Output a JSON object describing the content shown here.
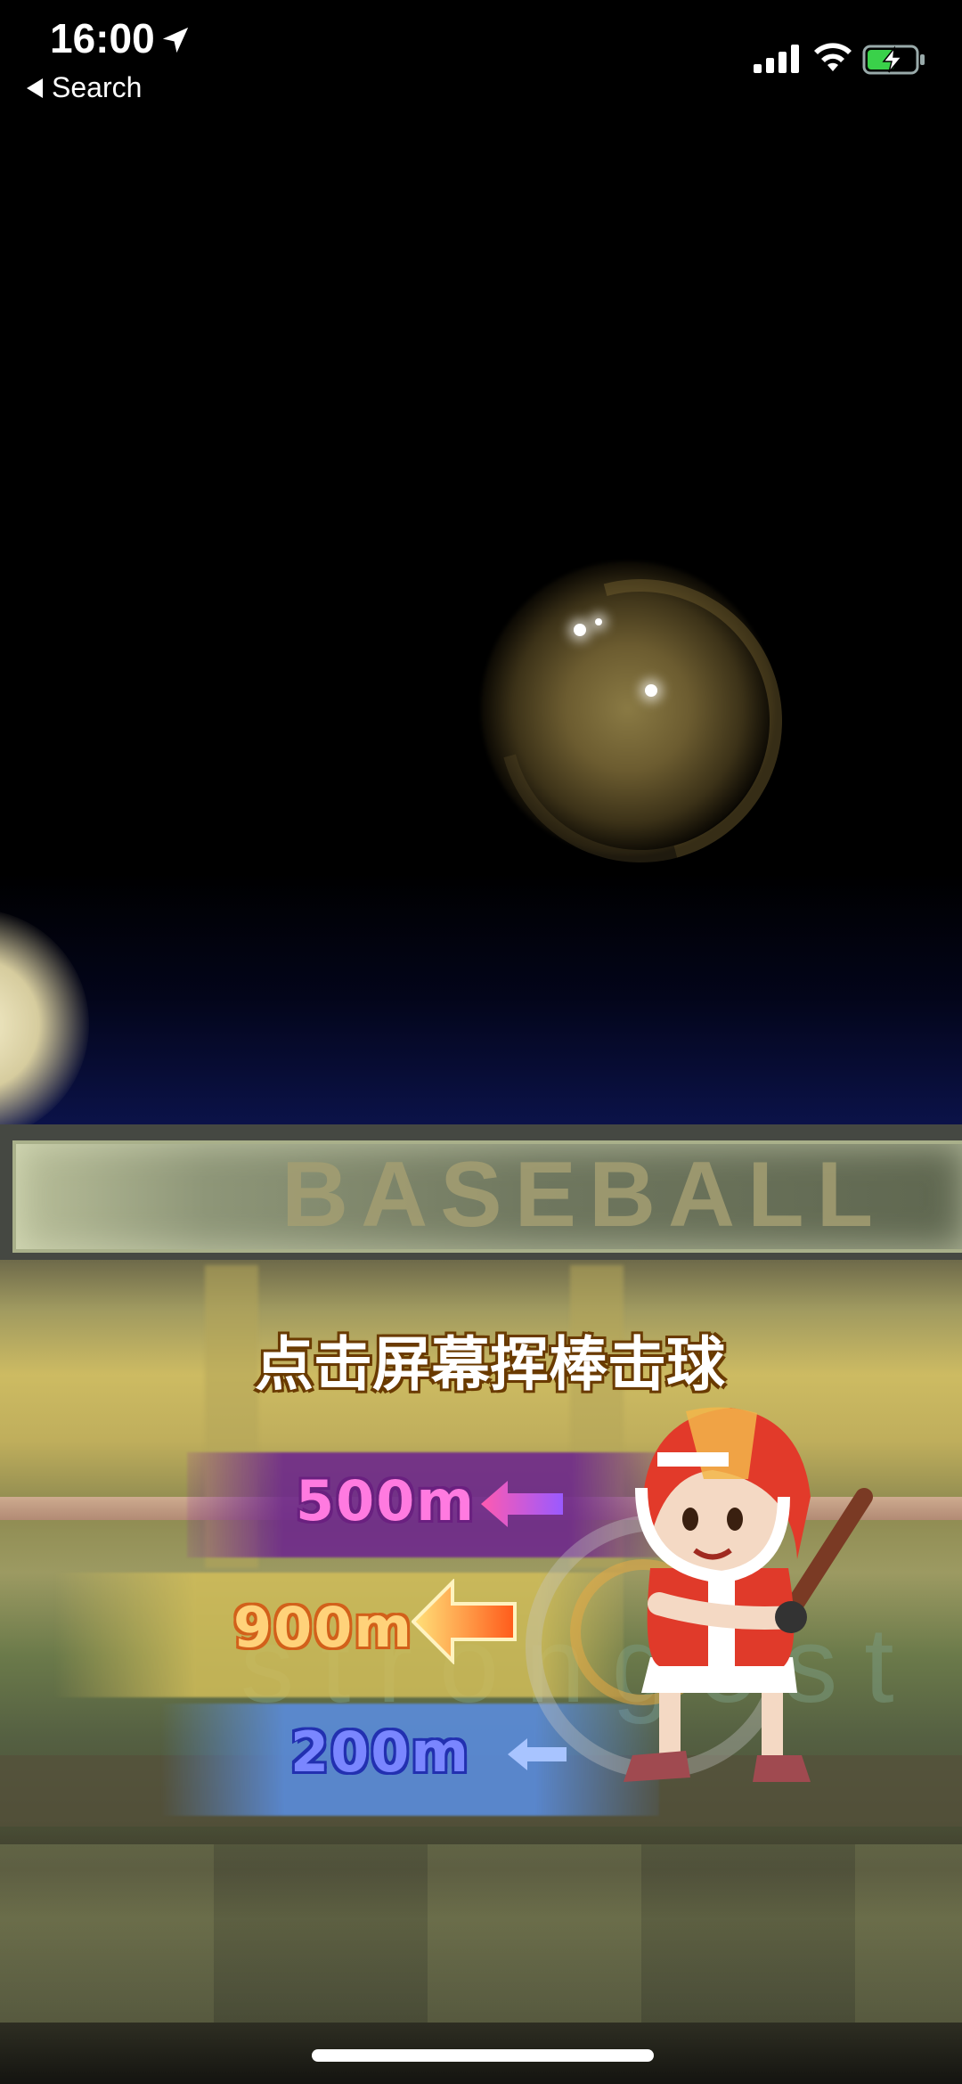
{
  "status_bar": {
    "time": "16:00",
    "back_label": "Search",
    "icons": [
      "location-arrow-icon",
      "signal-icon",
      "wifi-icon",
      "battery-charging-icon"
    ]
  },
  "scene": {
    "board_text": "BASEBALL",
    "watermark_text": "strongest",
    "instruction": "点击屏幕挥棒击球"
  },
  "distances": [
    {
      "label": "500m",
      "color": "#ff7ae0"
    },
    {
      "label": "900m",
      "color": "#ffd27a"
    },
    {
      "label": "200m",
      "color": "#7a86ff"
    }
  ],
  "colors": {
    "sky": "#000000",
    "accent_pink": "#ff7ae0",
    "accent_orange": "#ff8a30",
    "accent_blue": "#7a86ff"
  }
}
